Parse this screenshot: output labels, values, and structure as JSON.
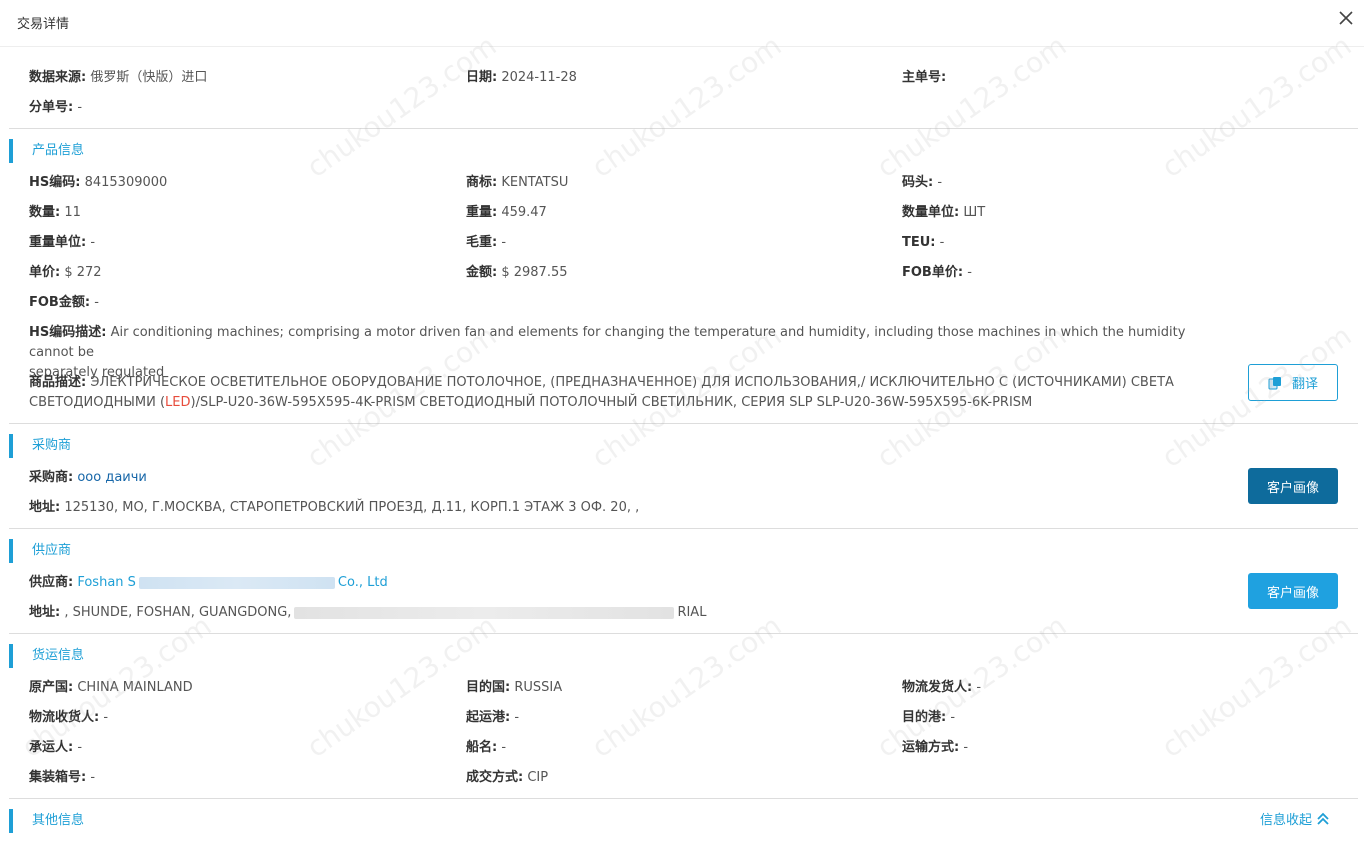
{
  "dialog": {
    "title": "交易详情"
  },
  "top": {
    "source_label": "数据来源:",
    "source_value": "俄罗斯（快版）进口",
    "date_label": "日期:",
    "date_value": "2024-11-28",
    "master_label": "主单号:",
    "master_value": "",
    "sub_label": "分单号:",
    "sub_value": "-"
  },
  "product": {
    "section_title": "产品信息",
    "hs_label": "HS编码:",
    "hs_value": "8415309000",
    "brand_label": "商标:",
    "brand_value": "KENTATSU",
    "mark_label": "码头:",
    "mark_value": "-",
    "qty_label": "数量:",
    "qty_value": "11",
    "weight_label": "重量:",
    "weight_value": "459.47",
    "qty_unit_label": "数量单位:",
    "qty_unit_value": "ШТ",
    "weight_unit_label": "重量单位:",
    "weight_unit_value": "-",
    "gross_label": "毛重:",
    "gross_value": "-",
    "teu_label": "TEU:",
    "teu_value": "-",
    "price_label": "单价:",
    "price_value": "$ 272",
    "amount_label": "金额:",
    "amount_value": "$ 2987.55",
    "fob_price_label": "FOB单价:",
    "fob_price_value": "-",
    "fob_amount_label": "FOB金额:",
    "fob_amount_value": "-",
    "hs_desc_label": "HS编码描述:",
    "hs_desc_line1": "Air conditioning machines; comprising a motor driven fan and elements for changing the temperature and humidity, including those machines in which the humidity cannot be",
    "hs_desc_line2": "separately regulated",
    "goods_desc_label": "商品描述:",
    "goods_desc_line1": "ЭЛЕКТРИЧЕСКОЕ ОСВЕТИТЕЛЬНОЕ ОБОРУДОВАНИЕ ПОТОЛОЧНОЕ, (ПРЕДНАЗНАЧЕННОЕ) ДЛЯ ИСПОЛЬЗОВАНИЯ,/ ИСКЛЮЧИТЕЛЬНО С (ИСТОЧНИКАМИ) СВЕТА",
    "goods_desc_line2a": "СВЕТОДИОДНЫМИ (",
    "goods_desc_led": "LED",
    "goods_desc_line2b": ")/SLP-U20-36W-595X595-4K-PRISM СВЕТОДИОДНЫЙ ПОТОЛОЧНЫЙ СВЕТИЛЬНИК, СЕРИЯ SLP SLP-U20-36W-595X595-6K-PRISM",
    "translate_label": "翻译"
  },
  "buyer": {
    "section_title": "采购商",
    "name_label": "采购商:",
    "name_value": "ооо даичи",
    "address_label": "地址:",
    "address_value": "125130, МО, Г.МОСКВА, СТАРОПЕТРОВСКИЙ ПРОЕЗД, Д.11, КОРП.1 ЭТАЖ 3 ОФ. 20, ,",
    "profile_button": "客户画像"
  },
  "supplier": {
    "section_title": "供应商",
    "name_label": "供应商:",
    "name_prefix": "Foshan S",
    "name_suffix": "Co., Ltd",
    "address_label": "地址:",
    "address_prefix": ", SHUNDE, FOSHAN, GUANGDONG,",
    "address_suffix": "RIAL",
    "profile_button": "客户画像"
  },
  "shipping": {
    "section_title": "货运信息",
    "origin_label": "原产国:",
    "origin_value": "CHINA MAINLAND",
    "dest_label": "目的国:",
    "dest_value": "RUSSIA",
    "shipper_label": "物流发货人:",
    "shipper_value": "-",
    "consignee_label": "物流收货人:",
    "consignee_value": "-",
    "depart_port_label": "起运港:",
    "depart_port_value": "-",
    "dest_port_label": "目的港:",
    "dest_port_value": "-",
    "carrier_label": "承运人:",
    "carrier_value": "-",
    "vessel_label": "船名:",
    "vessel_value": "-",
    "transport_label": "运输方式:",
    "transport_value": "-",
    "container_label": "集装箱号:",
    "container_value": "-",
    "deal_label": "成交方式:",
    "deal_value": "CIP"
  },
  "other": {
    "section_title": "其他信息",
    "collapse_label": "信息收起"
  },
  "watermark": "chukou123.com"
}
